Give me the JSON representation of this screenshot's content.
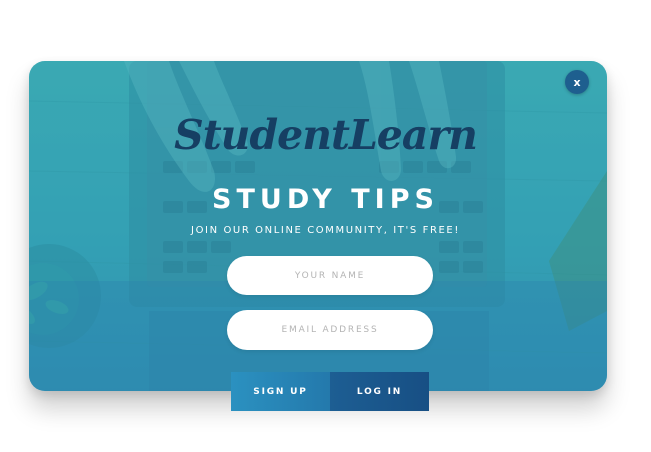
{
  "popup": {
    "close_label": "x",
    "logo_text": "StudentLearn",
    "title": "STUDY TIPS",
    "subtitle": "JOIN OUR ONLINE COMMUNITY, IT'S FREE!",
    "name_placeholder": "YOUR NAME",
    "email_placeholder": "EMAIL ADDRESS",
    "signup_label": "SIGN UP",
    "login_label": "LOG IN"
  },
  "colors": {
    "overlay_top": "#3aabb4",
    "overlay_bottom": "#2b86b1",
    "logo": "#163f63",
    "close_button": "#1e5f8f",
    "signup_button": "#2b91c0",
    "login_button": "#174f84"
  },
  "icons": {
    "close": "close-icon"
  }
}
